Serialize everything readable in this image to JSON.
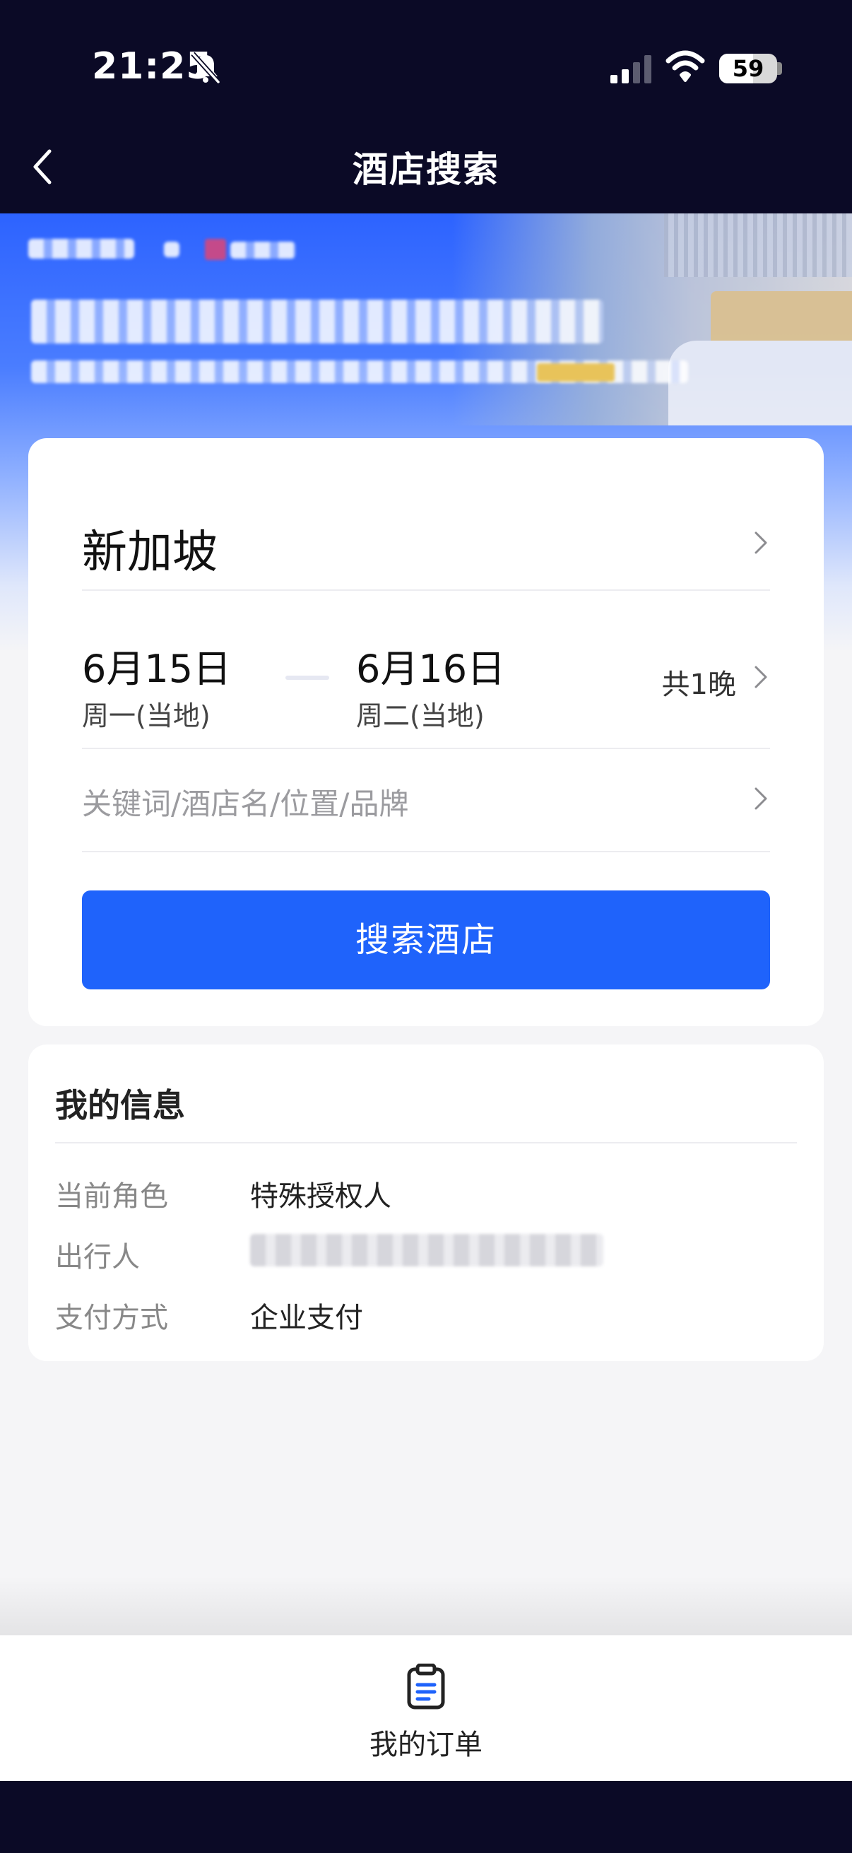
{
  "status_bar": {
    "time": "21:25",
    "battery": "59",
    "battery_level_percent": 59
  },
  "nav": {
    "title": "酒店搜索",
    "back_icon": "chevron-left-icon"
  },
  "search": {
    "city": "新加坡",
    "checkin_date": "6月15日",
    "checkin_weekday": "周一(当地)",
    "checkout_date": "6月16日",
    "checkout_weekday": "周二(当地)",
    "nights": "共1晚",
    "keyword_placeholder": "关键词/酒店名/位置/品牌",
    "search_button": "搜索酒店"
  },
  "my_info": {
    "title": "我的信息",
    "rows": [
      {
        "label": "当前角色",
        "value": "特殊授权人"
      },
      {
        "label": "出行人",
        "value": ""
      },
      {
        "label": "支付方式",
        "value": "企业支付"
      }
    ]
  },
  "bottom_nav": {
    "orders_label": "我的订单",
    "orders_icon": "clipboard-list-icon"
  },
  "colors": {
    "primary": "#1f63fb",
    "topbar": "#0b0a26",
    "background": "#f5f5f7"
  }
}
